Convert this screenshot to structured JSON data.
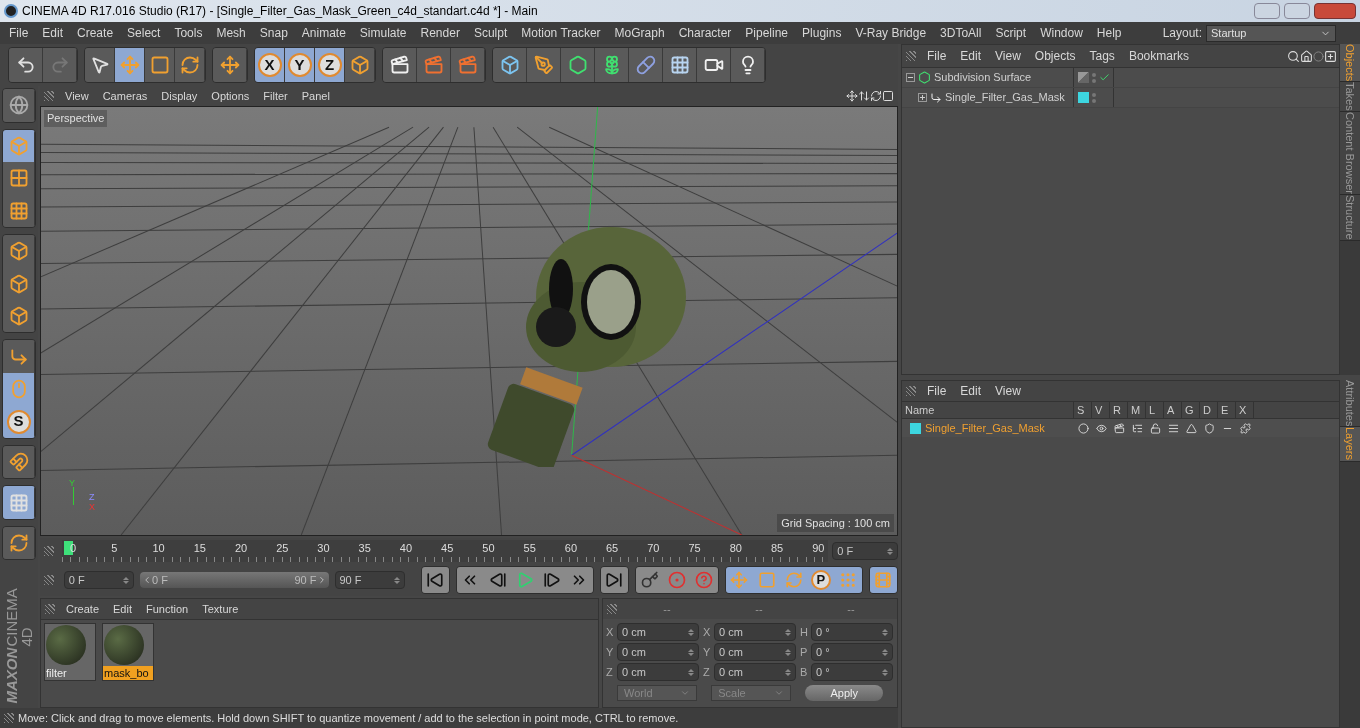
{
  "window": {
    "title": "CINEMA 4D R17.016 Studio (R17) - [Single_Filter_Gas_Mask_Green_c4d_standart.c4d *] - Main"
  },
  "menu_bar": [
    "File",
    "Edit",
    "Create",
    "Select",
    "Tools",
    "Mesh",
    "Snap",
    "Animate",
    "Simulate",
    "Render",
    "Sculpt",
    "Motion Tracker",
    "MoGraph",
    "Character",
    "Pipeline",
    "Plugins",
    "V-Ray Bridge",
    "3DToAll",
    "Script",
    "Window",
    "Help"
  ],
  "layout": {
    "label": "Layout:",
    "value": "Startup"
  },
  "toolbar": [
    [
      {
        "kind": "undo",
        "selected": false
      },
      {
        "kind": "redo",
        "selected": false
      }
    ],
    [
      {
        "kind": "select",
        "selected": false
      },
      {
        "kind": "move",
        "selected": true
      },
      {
        "kind": "scale",
        "selected": false
      },
      {
        "kind": "rotate",
        "selected": false
      }
    ],
    [
      {
        "kind": "live",
        "selected": false
      }
    ],
    [
      {
        "kind": "axis-letter",
        "label": "X",
        "selected": true
      },
      {
        "kind": "axis-letter",
        "label": "Y",
        "selected": true
      },
      {
        "kind": "axis-letter",
        "label": "Z",
        "selected": true
      },
      {
        "kind": "coord",
        "selected": false
      }
    ],
    [
      {
        "kind": "render-view",
        "selected": false
      },
      {
        "kind": "render",
        "selected": false
      },
      {
        "kind": "render-settings",
        "selected": false
      }
    ],
    [
      {
        "kind": "cube",
        "selected": false
      },
      {
        "kind": "pen",
        "selected": false
      },
      {
        "kind": "subdiv",
        "selected": false
      },
      {
        "kind": "cloner",
        "selected": false
      },
      {
        "kind": "deformer",
        "selected": false
      },
      {
        "kind": "floor",
        "selected": false
      },
      {
        "kind": "camera",
        "selected": false
      },
      {
        "kind": "light",
        "selected": false
      }
    ]
  ],
  "left_tools": [
    [
      {
        "kind": "view",
        "selected": false
      }
    ],
    [
      {
        "kind": "model",
        "selected": true
      },
      {
        "kind": "texture",
        "selected": false
      },
      {
        "kind": "workplane",
        "selected": false
      }
    ],
    [
      {
        "kind": "points",
        "selected": false
      },
      {
        "kind": "edges",
        "selected": false
      },
      {
        "kind": "polygons",
        "selected": false
      }
    ],
    [
      {
        "kind": "axis",
        "selected": false
      },
      {
        "kind": "tweak",
        "selected": true
      },
      {
        "kind": "snap",
        "label": "S",
        "selected": true
      }
    ],
    [
      {
        "kind": "magnet",
        "selected": false
      }
    ],
    [
      {
        "kind": "lock-grid",
        "selected": true
      }
    ],
    [
      {
        "kind": "grid-rotate",
        "selected": false
      }
    ]
  ],
  "logo": [
    "MAXON",
    "CINEMA 4D"
  ],
  "viewport": {
    "menu": [
      "View",
      "Cameras",
      "Display",
      "Options",
      "Filter",
      "Panel"
    ],
    "camera": "Perspective",
    "grid_spacing": "Grid Spacing : 100 cm",
    "axis_labels": [
      "Y",
      "Z",
      "X"
    ]
  },
  "timeline": {
    "ticks": [
      "0",
      "5",
      "10",
      "15",
      "20",
      "25",
      "30",
      "35",
      "40",
      "45",
      "50",
      "55",
      "60",
      "65",
      "70",
      "75",
      "80",
      "85",
      "90"
    ],
    "current_frame": "0 F",
    "start_field": "0 F",
    "range": {
      "start": "0 F",
      "end": "90 F",
      "level": 1
    },
    "end_field": "90 F",
    "buttons": [
      [
        {
          "kind": "go-start"
        }
      ],
      [
        {
          "kind": "prev-key"
        },
        {
          "kind": "prev-frame"
        },
        {
          "kind": "play"
        },
        {
          "kind": "next-frame"
        },
        {
          "kind": "next-key"
        }
      ],
      [
        {
          "kind": "go-end"
        }
      ],
      [
        {
          "kind": "key-off"
        },
        {
          "kind": "record"
        },
        {
          "kind": "autokey"
        }
      ],
      [
        {
          "kind": "move"
        },
        {
          "kind": "scale"
        },
        {
          "kind": "rotate"
        },
        {
          "kind": "param",
          "label": "P"
        },
        {
          "kind": "point-level"
        }
      ],
      [
        {
          "kind": "film"
        }
      ]
    ]
  },
  "materials": {
    "menu": [
      "Create",
      "Edit",
      "Function",
      "Texture"
    ],
    "items": [
      {
        "name": "filter",
        "selected": false
      },
      {
        "name": "mask_bo",
        "selected": true
      }
    ]
  },
  "coordinates": {
    "headers": [
      "--",
      "--",
      "--"
    ],
    "columns": [
      [
        {
          "label": "X",
          "value": "0 cm"
        },
        {
          "label": "Y",
          "value": "0 cm"
        },
        {
          "label": "Z",
          "value": "0 cm"
        }
      ],
      [
        {
          "label": "X",
          "value": "0 cm"
        },
        {
          "label": "Y",
          "value": "0 cm"
        },
        {
          "label": "Z",
          "value": "0 cm"
        }
      ],
      [
        {
          "label": "H",
          "value": "0 °"
        },
        {
          "label": "P",
          "value": "0 °"
        },
        {
          "label": "B",
          "value": "0 °"
        }
      ]
    ],
    "dropdowns": [
      "World",
      "Scale"
    ],
    "apply": "Apply"
  },
  "status_bar": "Move: Click and drag to move elements. Hold down SHIFT to quantize movement / add to the selection in point mode, CTRL to remove.",
  "objects": {
    "menu": [
      "File",
      "Edit",
      "View",
      "Objects",
      "Tags",
      "Bookmarks"
    ],
    "tree": [
      {
        "name": "Subdivision Surface",
        "kind": "subdiv",
        "expanded": true,
        "checked": true,
        "children": [
          {
            "name": "Single_Filter_Gas_Mask",
            "kind": "null",
            "expanded": false,
            "checked": false,
            "color": "#3dd6e0"
          }
        ]
      }
    ],
    "side_tabs": [
      {
        "label": "Objects",
        "selected": true
      },
      {
        "label": "Takes",
        "selected": false
      },
      {
        "label": "Content Browser",
        "selected": false
      },
      {
        "label": "Structure",
        "selected": false
      }
    ]
  },
  "layers": {
    "menu": [
      "File",
      "Edit",
      "View"
    ],
    "columns": [
      "Name",
      "S",
      "V",
      "R",
      "M",
      "L",
      "A",
      "G",
      "D",
      "E",
      "X"
    ],
    "rows": [
      {
        "name": "Single_Filter_Gas_Mask",
        "color": "#3dd6e0"
      }
    ],
    "side_tabs": [
      {
        "label": "Attributes",
        "selected": false
      },
      {
        "label": "Layers",
        "selected": true
      }
    ]
  }
}
